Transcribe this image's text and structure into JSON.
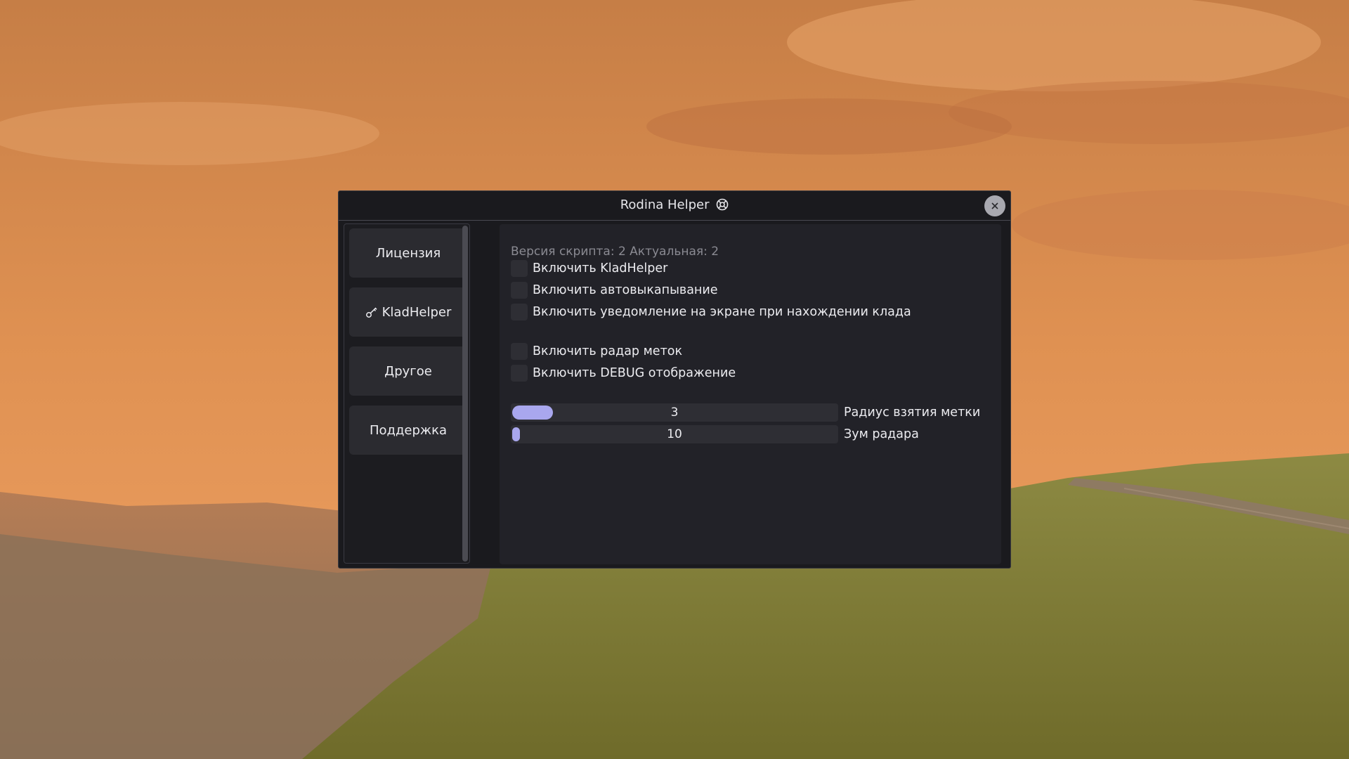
{
  "window": {
    "title": "Rodina Helper"
  },
  "sidebar": {
    "items": [
      {
        "label": "Лицензия",
        "icon": ""
      },
      {
        "label": "KladHelper",
        "icon": "key-icon"
      },
      {
        "label": "Другое",
        "icon": ""
      },
      {
        "label": "Поддержка",
        "icon": ""
      }
    ]
  },
  "content": {
    "version_text": "Версия скрипта: 2 Актуальная: 2",
    "checkboxes": [
      {
        "label": "Включить KladHelper",
        "checked": false
      },
      {
        "label": "Включить автовыкапывание",
        "checked": false
      },
      {
        "label": "Включить уведомление на экране при нахождении клада",
        "checked": false
      },
      {
        "label": "Включить радар меток",
        "checked": false
      },
      {
        "label": "Включить DEBUG отображение",
        "checked": false
      }
    ],
    "sliders": [
      {
        "label": "Радиус взятия метки",
        "value": "3",
        "level": 0.0
      },
      {
        "label": "Зум радара",
        "value": "10",
        "level": 0.0
      }
    ]
  },
  "colors": {
    "accent": "#a9a7ee",
    "window_bg": "#1a1a1e",
    "content_bg": "#222228",
    "button_bg": "#2b2b30",
    "sky": "#d98a4c",
    "grass": "#7c7a32"
  }
}
